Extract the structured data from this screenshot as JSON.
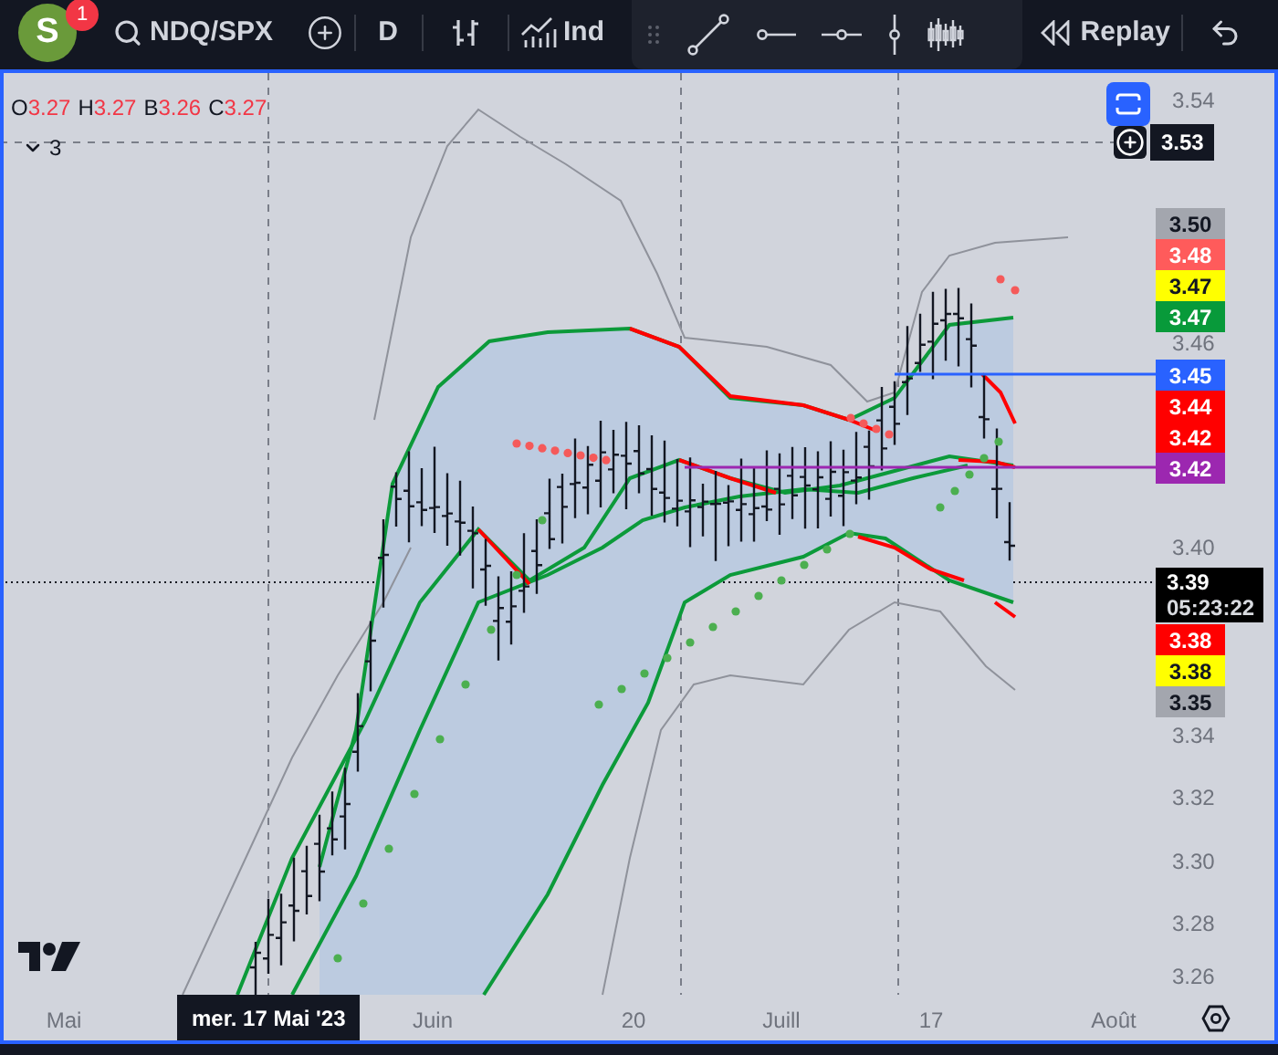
{
  "toolbar": {
    "avatar_letter": "S",
    "notification_count": "1",
    "symbol": "NDQ/SPX",
    "interval": "D",
    "indicators_label": "Ind",
    "replay_label": "Replay"
  },
  "legend": {
    "values": [
      {
        "label": "O",
        "value": "3.27"
      },
      {
        "label": "H",
        "value": "3.27"
      },
      {
        "label": "B",
        "value": "3.26"
      },
      {
        "label": "C",
        "value": "3.27"
      }
    ],
    "collapse_count": "3"
  },
  "price_axis": {
    "ticks": [
      "3.54",
      "3.46",
      "3.40",
      "3.34",
      "3.32",
      "3.30",
      "3.28",
      "3.26"
    ],
    "crosshair_price": "3.53",
    "badges": [
      {
        "text": "3.50",
        "color": "#a3a6ae"
      },
      {
        "text": "3.48",
        "color": "#ff5b5b"
      },
      {
        "text": "3.47",
        "color": "#ffff00"
      },
      {
        "text": "3.47",
        "color": "#089a3a"
      },
      {
        "text": "3.45",
        "color": "#2962ff"
      },
      {
        "text": "3.44",
        "color": "#ff0000"
      },
      {
        "text": "3.42",
        "color": "#ff0000"
      },
      {
        "text": "3.42",
        "color": "#9c27b0"
      },
      {
        "text": "3.38",
        "color": "#ff0000"
      },
      {
        "text": "3.38",
        "color": "#ffff00"
      },
      {
        "text": "3.35",
        "color": "#a3a6ae"
      }
    ]
  },
  "last_price": {
    "price": "3.39",
    "countdown": "05:23:22"
  },
  "time_axis": {
    "labels": [
      "Mai",
      "Juin",
      "20",
      "Juill",
      "17",
      "Août"
    ],
    "crosshair_date": "mer. 17 Mai '23"
  }
}
